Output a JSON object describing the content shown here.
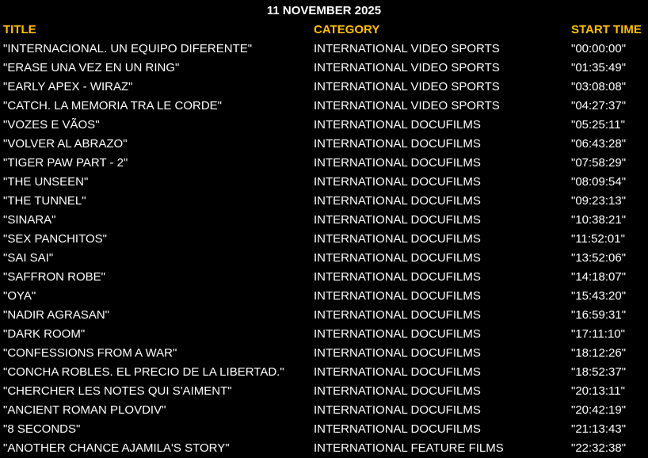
{
  "date": "11 NOVEMBER 2025",
  "headers": {
    "title": "TITLE",
    "category": "CATEGORY",
    "start_time": "START TIME"
  },
  "rows": [
    {
      "title": "\"INTERNACIONAL. UN EQUIPO DIFERENTE\"",
      "category": "INTERNATIONAL VIDEO SPORTS",
      "start": "\"00:00:00\""
    },
    {
      "title": "\"ERASE UNA VEZ EN UN RING\"",
      "category": "INTERNATIONAL VIDEO SPORTS",
      "start": "\"01:35:49\""
    },
    {
      "title": "\"EARLY APEX - WIRAZ\"",
      "category": "INTERNATIONAL VIDEO SPORTS",
      "start": "\"03:08:08\""
    },
    {
      "title": "\"CATCH. LA MEMORIA TRA LE CORDE\"",
      "category": "INTERNATIONAL VIDEO SPORTS",
      "start": "\"04:27:37\""
    },
    {
      "title": "\"VOZES E VÃOS\"",
      "category": "INTERNATIONAL DOCUFILMS",
      "start": "\"05:25:11\""
    },
    {
      "title": "\"VOLVER AL ABRAZO\"",
      "category": "INTERNATIONAL DOCUFILMS",
      "start": "\"06:43:28\""
    },
    {
      "title": "\"TIGER PAW PART - 2\"",
      "category": "INTERNATIONAL DOCUFILMS",
      "start": "\"07:58:29\""
    },
    {
      "title": "\"THE UNSEEN\"",
      "category": "INTERNATIONAL DOCUFILMS",
      "start": "\"08:09:54\""
    },
    {
      "title": "\"THE TUNNEL\"",
      "category": "INTERNATIONAL DOCUFILMS",
      "start": "\"09:23:13\""
    },
    {
      "title": "\"SINARA\"",
      "category": "INTERNATIONAL DOCUFILMS",
      "start": "\"10:38:21\""
    },
    {
      "title": "\"SEX PANCHITOS\"",
      "category": "INTERNATIONAL DOCUFILMS",
      "start": "\"11:52:01\""
    },
    {
      "title": "\"SAI SAI\"",
      "category": "INTERNATIONAL DOCUFILMS",
      "start": "\"13:52:06\""
    },
    {
      "title": "\"SAFFRON ROBE\"",
      "category": "INTERNATIONAL DOCUFILMS",
      "start": "\"14:18:07\""
    },
    {
      "title": "\"OYA\"",
      "category": "INTERNATIONAL DOCUFILMS",
      "start": "\"15:43:20\""
    },
    {
      "title": "\"NADIR AGRASAN\"",
      "category": "INTERNATIONAL DOCUFILMS",
      "start": "\"16:59:31\""
    },
    {
      "title": "\"DARK ROOM\"",
      "category": "INTERNATIONAL DOCUFILMS",
      "start": "\"17:11:10\""
    },
    {
      "title": "\"CONFESSIONS FROM A WAR\"",
      "category": "INTERNATIONAL DOCUFILMS",
      "start": "\"18:12:26\""
    },
    {
      "title": "\"CONCHA ROBLES. EL PRECIO DE LA LIBERTAD.\"",
      "category": "INTERNATIONAL DOCUFILMS",
      "start": "\"18:52:37\""
    },
    {
      "title": "\"CHERCHER LES NOTES QUI S'AIMENT\"",
      "category": "INTERNATIONAL DOCUFILMS",
      "start": "\"20:13:11\""
    },
    {
      "title": "\"ANCIENT ROMAN PLOVDIV\"",
      "category": "INTERNATIONAL DOCUFILMS",
      "start": "\"20:42:19\""
    },
    {
      "title": "\"8 SECONDS\"",
      "category": "INTERNATIONAL DOCUFILMS",
      "start": "\"21:13:43\""
    },
    {
      "title": "\"ANOTHER CHANCE AJAMILA'S STORY\"",
      "category": "INTERNATIONAL FEATURE FILMS",
      "start": "\"22:32:38\""
    }
  ],
  "colors": {
    "background": "#000000",
    "header_text": "#ffc000",
    "body_text": "#ffffff"
  }
}
